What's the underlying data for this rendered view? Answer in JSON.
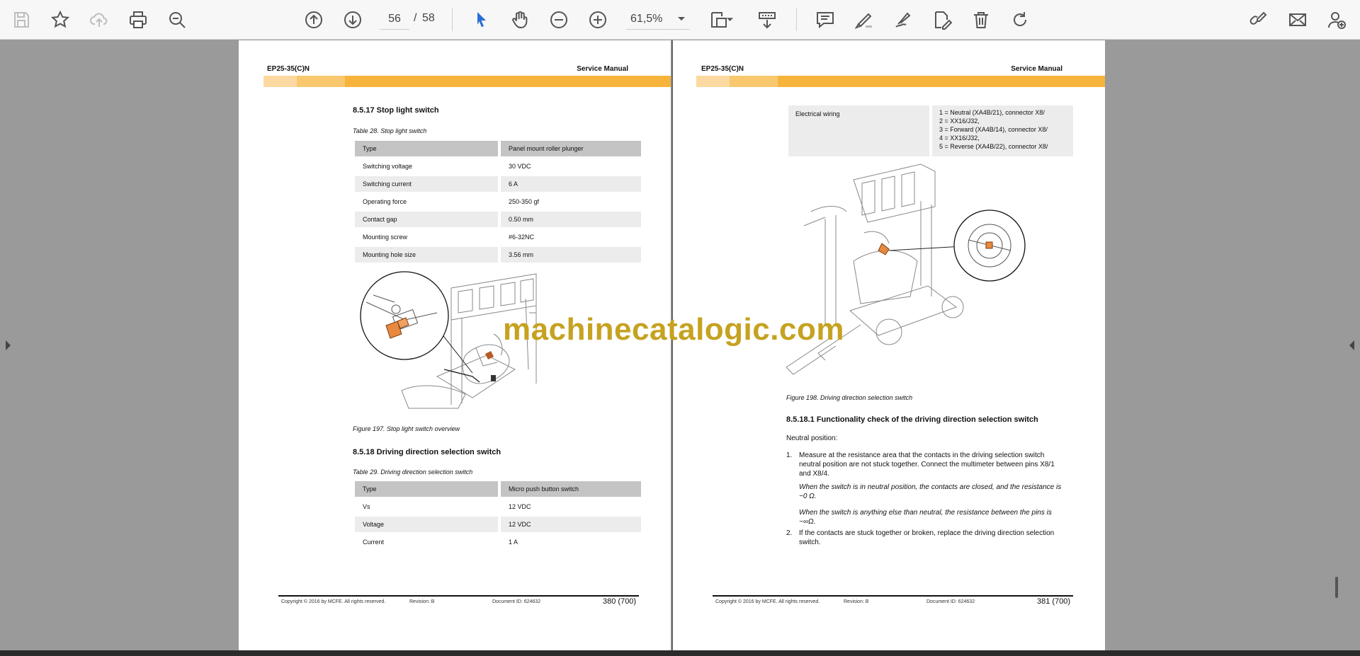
{
  "toolbar": {
    "page_current": "56",
    "page_separator": "/",
    "page_total": "58",
    "zoom": "61,5%"
  },
  "colors": {
    "accent": "#f6b43c",
    "accent_light": "#fbd9a0",
    "accent_mid": "#f9c86e",
    "watermark": "#c6a221",
    "highlight_part": "#e8893f"
  },
  "pages": [
    {
      "model": "EP25-35(C)N",
      "manual": "Service Manual",
      "section1": {
        "title": "8.5.17    Stop light switch",
        "table_caption": "Table 28. Stop light switch",
        "rows": [
          [
            "Type",
            "Panel mount roller plunger"
          ],
          [
            "Switching voltage",
            "30 VDC"
          ],
          [
            "Switching current",
            "6 A"
          ],
          [
            "Operating force",
            "250-350 gf"
          ],
          [
            "Contact gap",
            "0.50 mm"
          ],
          [
            "Mounting screw",
            "#6-32NC"
          ],
          [
            "Mounting hole size",
            "3.56 mm"
          ]
        ],
        "figure_caption": "Figure 197. Stop light switch overview"
      },
      "section2": {
        "title": "8.5.18    Driving direction selection switch",
        "table_caption": "Table 29. Driving direction selection switch",
        "rows": [
          [
            "Type",
            "Micro push button switch"
          ],
          [
            "Vs",
            "12 VDC"
          ],
          [
            "Voltage",
            "12 VDC"
          ],
          [
            "Current",
            "1 A"
          ]
        ]
      },
      "footer": {
        "copyright": "Copyright © 2016 by MCFE. All rights reserved.",
        "revision": "Revision: B",
        "document_id": "Document ID: 624632",
        "page_number": "380 (700)"
      }
    },
    {
      "model": "EP25-35(C)N",
      "manual": "Service Manual",
      "wiring": {
        "label": "Electrical wiring",
        "values": [
          "1 = Neutral (XA4B/21), connector X8/",
          "2 = XX16/J32,",
          "3 = Forward (XA4B/14), connector X8/",
          "4 = XX16/J32,",
          "5 = Reverse (XA4B/22), connector X8/"
        ]
      },
      "figure_caption": "Figure 198. Driving direction selection switch",
      "section": {
        "title": "8.5.18.1 Functionality check of the driving direction selection switch",
        "intro": "Neutral position:",
        "step1_num": "1.",
        "step1_lines": [
          "Measure at the resistance area that the contacts in the driving selection switch",
          "neutral position are not stuck together. Connect the multimeter between pins X8/1",
          "and X8/4."
        ],
        "step1_note1_lines": [
          "When the switch is in neutral position, the contacts are closed, and the resistance is",
          "~0 Ω."
        ],
        "step1_note2_lines": [
          "When the switch is anything else than neutral, the resistance between the pins is",
          "~∞Ω."
        ],
        "step2_num": "2.",
        "step2_lines": [
          "If the contacts are stuck together or broken, replace the driving direction selection",
          "switch."
        ]
      },
      "footer": {
        "copyright": "Copyright © 2016 by MCFE. All rights reserved.",
        "revision": "Revision: B",
        "document_id": "Document ID: 624632",
        "page_number": "381 (700)"
      }
    }
  ],
  "watermark": "machinecatalogic.com"
}
